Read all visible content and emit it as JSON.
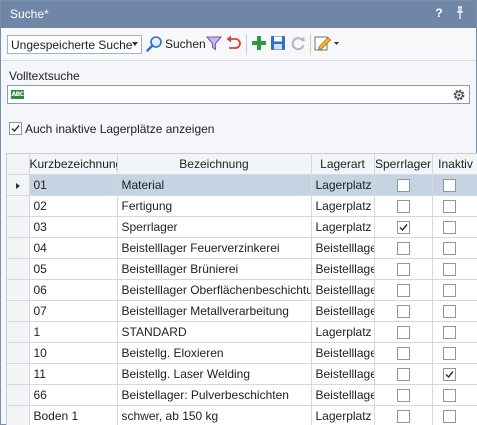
{
  "panel": {
    "title": "Suche*",
    "help_label": "?",
    "pin_label": "͢"
  },
  "toolbar": {
    "saved_search_value": "Ungespeicherte Suche",
    "search_label": "Suchen"
  },
  "fulltext": {
    "label": "Volltextsuche",
    "value": "",
    "badge": "ABC"
  },
  "inactive_option": {
    "label": "Auch inaktive Lagerplätze anzeigen",
    "checked": true
  },
  "grid": {
    "columns": [
      "Kurzbezeichnung",
      "Bezeichnung",
      "Lagerart",
      "Sperrlager",
      "Inaktiv"
    ],
    "rows": [
      {
        "kurz": "01",
        "bez": "Material",
        "art": "Lagerplatz",
        "sperr": false,
        "inaktiv": false,
        "selected": true
      },
      {
        "kurz": "02",
        "bez": "Fertigung",
        "art": "Lagerplatz",
        "sperr": false,
        "inaktiv": false
      },
      {
        "kurz": "03",
        "bez": "Sperrlager",
        "art": "Lagerplatz",
        "sperr": true,
        "inaktiv": false
      },
      {
        "kurz": "04",
        "bez": "Beistelllager Feuerverzinkerei",
        "art": "Beistelllager",
        "sperr": false,
        "inaktiv": false
      },
      {
        "kurz": "05",
        "bez": "Beistelllager Brünierei",
        "art": "Beistelllager",
        "sperr": false,
        "inaktiv": false
      },
      {
        "kurz": "06",
        "bez": "Beistelllager Oberflächenbeschichtung",
        "art": "Beistelllager",
        "sperr": false,
        "inaktiv": false
      },
      {
        "kurz": "07",
        "bez": "Beistelllager Metallverarbeitung",
        "art": "Beistelllager",
        "sperr": false,
        "inaktiv": false
      },
      {
        "kurz": "1",
        "bez": "STANDARD",
        "art": "Lagerplatz",
        "sperr": false,
        "inaktiv": false
      },
      {
        "kurz": "10",
        "bez": "Beistellg. Eloxieren",
        "art": "Beistelllager",
        "sperr": false,
        "inaktiv": false
      },
      {
        "kurz": "11",
        "bez": "Beistellg. Laser Welding",
        "art": "Beistelllager",
        "sperr": false,
        "inaktiv": true
      },
      {
        "kurz": "66",
        "bez": "Beistellager: Pulverbeschichten",
        "art": "Beistelllager",
        "sperr": false,
        "inaktiv": false
      },
      {
        "kurz": "Boden 1",
        "bez": "schwer, ab 150 kg",
        "art": "Lagerplatz",
        "sperr": false,
        "inaktiv": false
      }
    ]
  },
  "colors": {
    "titlebar": "#6f86a6",
    "selected_row": "#c6d3e3",
    "accent_green": "#2e9a3e",
    "accent_blue": "#2f6fc4"
  },
  "icons": [
    "search-icon",
    "filter-icon",
    "undo-icon",
    "add-icon",
    "save-icon",
    "refresh-icon",
    "edit-icon",
    "gear-icon",
    "pin-icon"
  ]
}
